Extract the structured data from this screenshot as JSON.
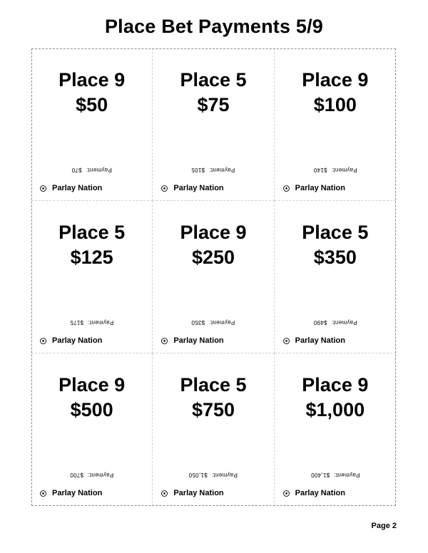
{
  "title": "Place Bet Payments 5/9",
  "brand": "Parlay Nation",
  "payment_label": "Payment:",
  "page_label": "Page 2",
  "cards": [
    {
      "bet": "Place 9",
      "amount": "$50",
      "payment": "$70"
    },
    {
      "bet": "Place 5",
      "amount": "$75",
      "payment": "$105"
    },
    {
      "bet": "Place 9",
      "amount": "$100",
      "payment": "$140"
    },
    {
      "bet": "Place 5",
      "amount": "$125",
      "payment": "$175"
    },
    {
      "bet": "Place 9",
      "amount": "$250",
      "payment": "$350"
    },
    {
      "bet": "Place 5",
      "amount": "$350",
      "payment": "$490"
    },
    {
      "bet": "Place 9",
      "amount": "$500",
      "payment": "$700"
    },
    {
      "bet": "Place 5",
      "amount": "$750",
      "payment": "$1,050"
    },
    {
      "bet": "Place 9",
      "amount": "$1,000",
      "payment": "$1,400"
    }
  ]
}
